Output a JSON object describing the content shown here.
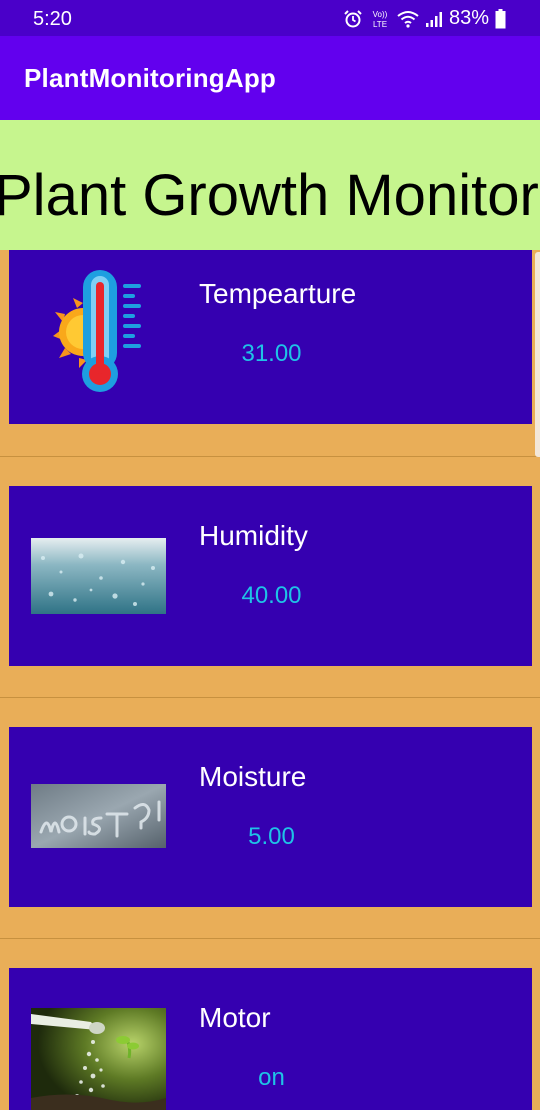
{
  "status_bar": {
    "time": "5:20",
    "battery": "83%"
  },
  "app_bar": {
    "title": "PlantMonitoringApp"
  },
  "header": {
    "title": "Plant Growth Monitor"
  },
  "sensors": [
    {
      "label": "Tempearture",
      "value": "31.00",
      "icon": "thermometer-sun-icon"
    },
    {
      "label": "Humidity",
      "value": "40.00",
      "icon": "water-droplets-photo"
    },
    {
      "label": "Moisture",
      "value": "5.00",
      "icon": "moist-window-photo"
    },
    {
      "label": "Motor",
      "value": "on",
      "icon": "watering-can-photo"
    }
  ],
  "colors": {
    "status_bar": "#4A00C9",
    "app_bar": "#6200EE",
    "header_banner": "#C6F58E",
    "card": "#3500B0",
    "list_background": "#E9AE58",
    "value_text": "#1FC3E6"
  }
}
